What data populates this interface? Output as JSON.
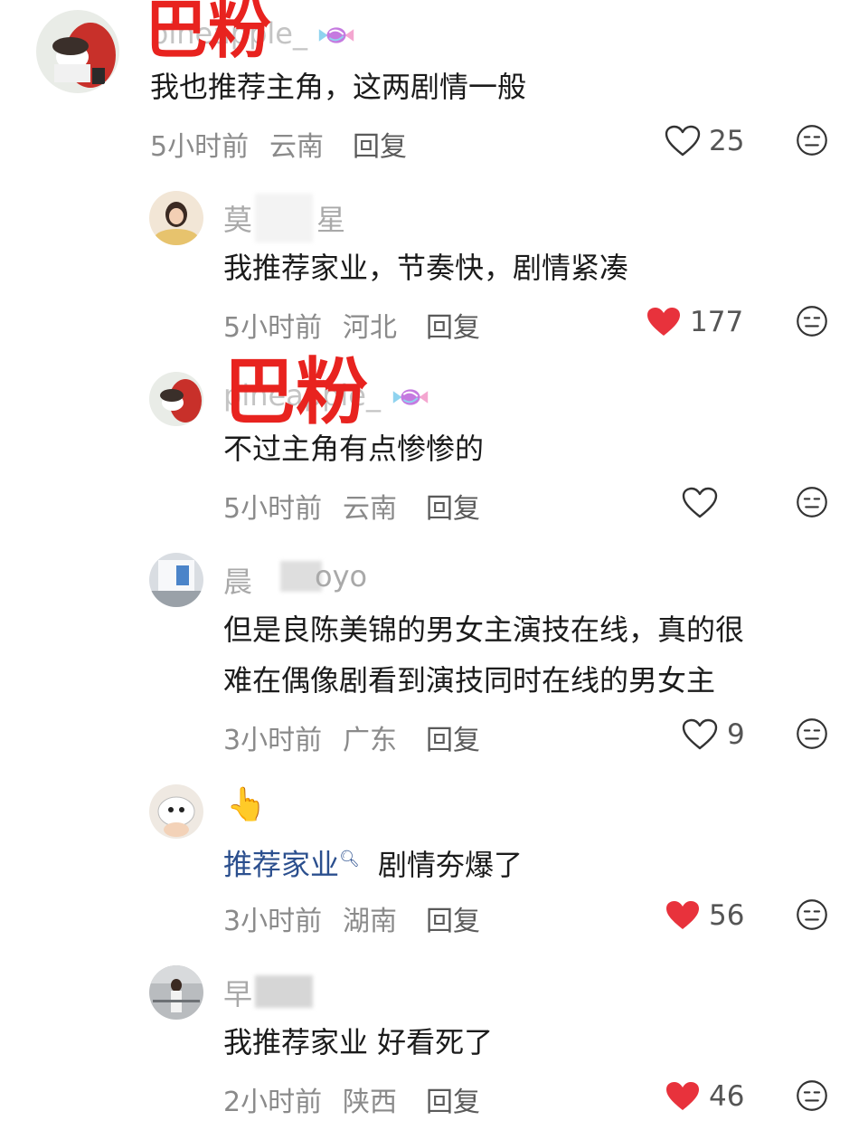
{
  "overlay_label": "巴粉",
  "reply_label": "回复",
  "comments": [
    {
      "username": "pineapple_",
      "text": "我也推荐主角，这两剧情一般",
      "time": "5小时前",
      "location": "云南",
      "likes": "25",
      "liked": false
    },
    {
      "username": "莫",
      "username_tail": "星",
      "text": "我推荐家业，节奏快，剧情紧凑",
      "time": "5小时前",
      "location": "河北",
      "likes": "177",
      "liked": true
    },
    {
      "username": "pineapple_",
      "text": "不过主角有点惨惨的",
      "time": "5小时前",
      "location": "云南",
      "likes": "",
      "liked": false
    },
    {
      "username": "晨",
      "username_tail": "oyo",
      "text_lines": [
        "但是良陈美锦的男女主演技在线，真的很",
        "难在偶像剧看到演技同时在线的男女主"
      ],
      "time": "3小时前",
      "location": "广东",
      "likes": "9",
      "liked": false
    },
    {
      "username": "👆",
      "text_link": "推荐家业",
      "text_rest": "剧情夯爆了",
      "time": "3小时前",
      "location": "湖南",
      "likes": "56",
      "liked": true
    },
    {
      "username": "早",
      "text": "我推荐家业 好看死了",
      "time": "2小时前",
      "location": "陕西",
      "likes": "46",
      "liked": true
    }
  ],
  "colors": {
    "like_active": "#e8323c",
    "overlay_red": "#e8231f",
    "link_blue": "#2b4f8e"
  },
  "icons": [
    "heart-outline-icon",
    "heart-filled-icon",
    "dislike-face-icon",
    "candy-icon",
    "search-icon"
  ]
}
